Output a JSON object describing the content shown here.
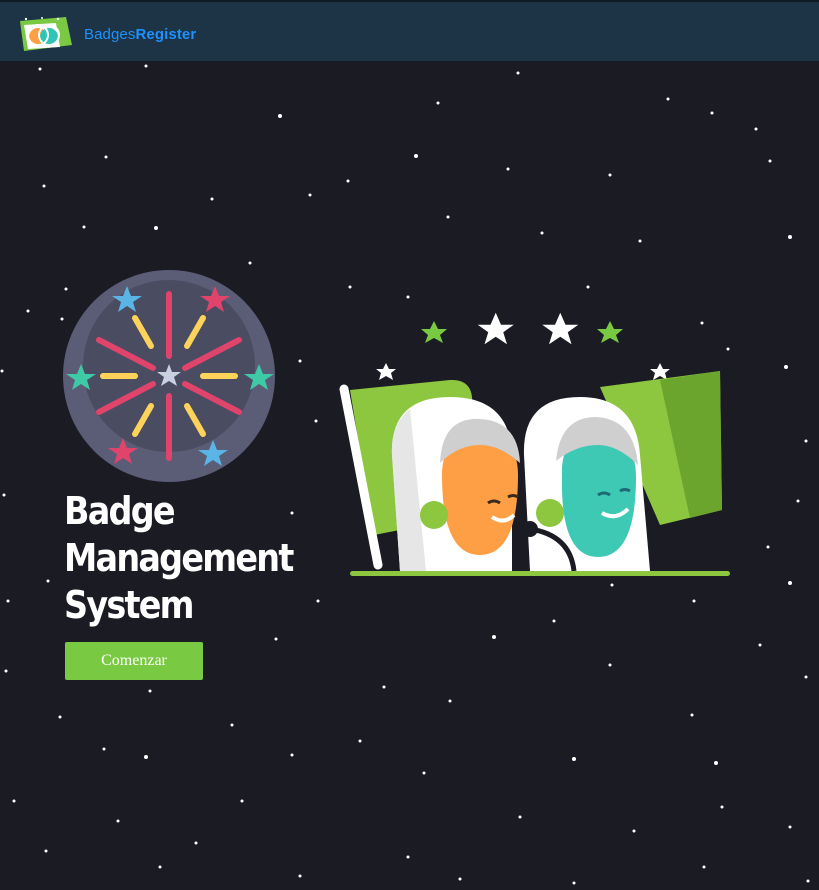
{
  "navbar": {
    "logo_icon": "badges-register-logo-icon",
    "brand_light": "Badges",
    "brand_bold": "Register",
    "brand_color": "#1e90ff",
    "background": "#1c3445"
  },
  "hero": {
    "title_lines": [
      "Badge",
      "Management",
      "System"
    ],
    "cta_label": "Comenzar",
    "cta_color": "#7ac943",
    "confetti_icon": "confetti-platform-icon",
    "illustration_icon": "astronauts-flag-illustration"
  },
  "page": {
    "background": "#1b1b24"
  }
}
